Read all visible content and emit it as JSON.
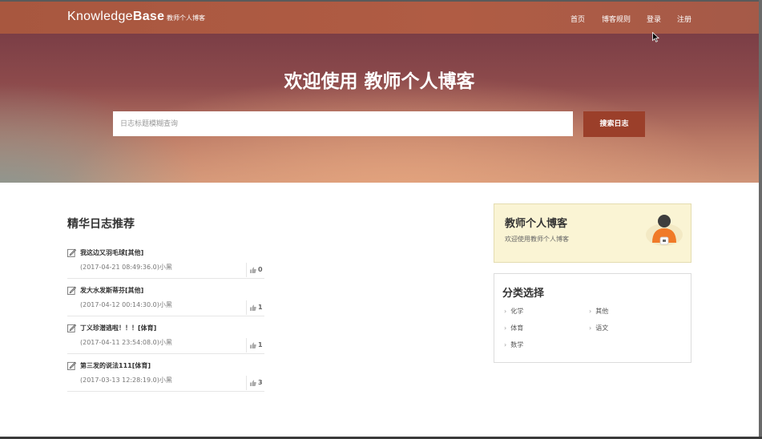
{
  "navbar": {
    "brand_plain": "Knowledge",
    "brand_bold": "Base",
    "brand_sub": "教师个人博客",
    "links": [
      "首页",
      "博客规则",
      "登录",
      "注册"
    ]
  },
  "hero": {
    "title": "欢迎使用 教师个人博客",
    "search_placeholder": "日志标题模糊查询",
    "search_button": "搜索日志"
  },
  "featured": {
    "heading": "精华日志推荐",
    "posts": [
      {
        "title": "我这边又羽毛球[其他]",
        "meta": "(2017-04-21 08:49:36.0)小黑",
        "likes": "0"
      },
      {
        "title": "发大水发斯蒂芬[其他]",
        "meta": "(2017-04-12 00:14:30.0)小黑",
        "likes": "1"
      },
      {
        "title": "丁义珍潜逃啦！！！[体育]",
        "meta": "(2017-04-11 23:54:08.0)小黑",
        "likes": "1"
      },
      {
        "title": "第三发的说法111[体育]",
        "meta": "(2017-03-13 12:28:19.0)小黑",
        "likes": "3"
      }
    ]
  },
  "profile": {
    "name": "教师个人博客",
    "subtitle": "欢迎使用教师个人博客"
  },
  "categories": {
    "heading": "分类选择",
    "items": [
      "化学",
      "其他",
      "体育",
      "语文",
      "数学"
    ]
  },
  "colors": {
    "navbar": "#a8573f",
    "search_button": "#9b3f2a",
    "profile_bg": "#faf4d4",
    "avatar_orange": "#f07a28"
  }
}
